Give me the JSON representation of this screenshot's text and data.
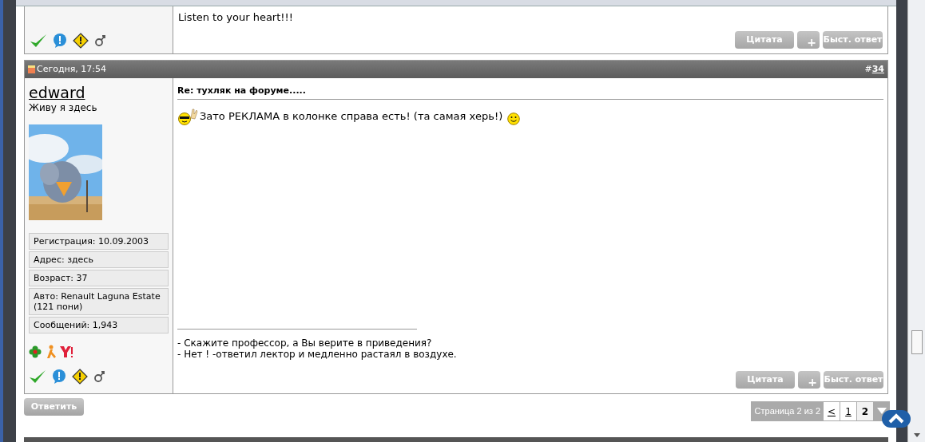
{
  "previous_post": {
    "message": "Listen to your heart!!!",
    "buttons": [
      "Цитата",
      "+",
      "Быст. ответ"
    ]
  },
  "post": {
    "date": "Сегодня, 17:54",
    "number_prefix": "#",
    "number": "34",
    "author": {
      "name": "edward",
      "title": "Живу я здесь",
      "fields": [
        "Регистрация: 10.09.2003",
        "Адрес: здесь",
        "Возраст: 37",
        "Авто: Renault Laguna Estate (121 пони)",
        "Сообщений: 1,943"
      ]
    },
    "subject": "Re: тухляк на форуме.....",
    "message": "Зато РЕКЛАМА в колонке справа есть! (та самая херь!)",
    "signature": [
      "- Скажите профессор, а Вы верите в приведения?",
      "- Нет ! -ответил лектор и медленно растаял в воздухе."
    ],
    "buttons": [
      "Цитата",
      "+",
      "Быст. ответ"
    ]
  },
  "reply_button": "Ответить",
  "pagination": {
    "label": "Страница 2 из 2",
    "pages": [
      {
        "label": "<",
        "selected": false
      },
      {
        "label": "1",
        "selected": false
      },
      {
        "label": "2",
        "selected": true
      }
    ]
  }
}
